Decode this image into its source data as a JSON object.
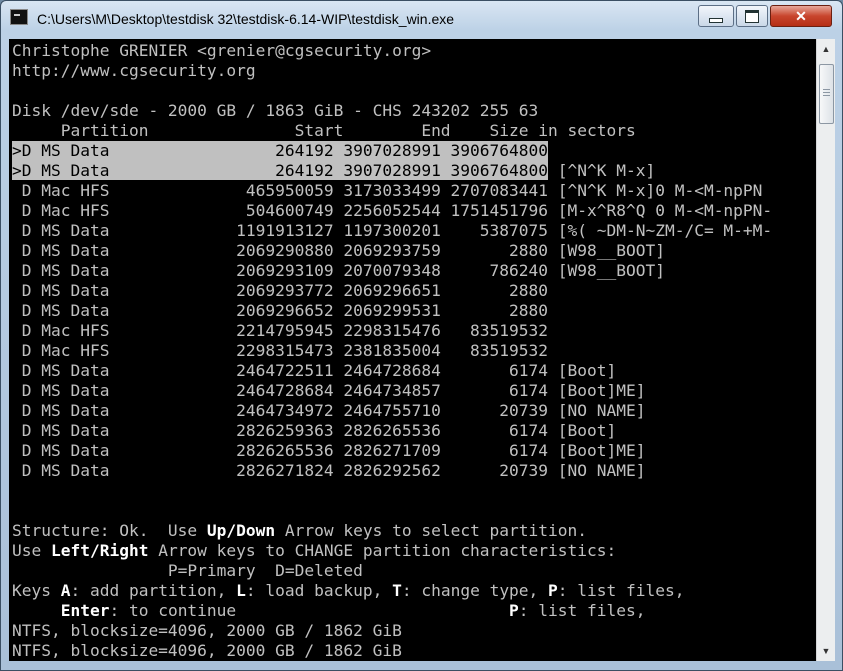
{
  "window": {
    "title": "C:\\Users\\M\\Desktop\\testdisk 32\\testdisk-6.14-WIP\\testdisk_win.exe",
    "close_label": "✕"
  },
  "console": {
    "author": "Christophe GRENIER <grenier@cgsecurity.org>",
    "url": "http://www.cgsecurity.org",
    "disk": "Disk /dev/sde - 2000 GB / 1863 GiB - CHS 243202 255 63",
    "header": "     Partition               Start        End    Size in sectors",
    "rows": [
      ">D MS Data                 264192 3907028991 3906764800",
      ">D MS Data                 264192 3907028991 3906764800",
      " D Mac HFS              465950059 3173033499 2707083441 [^N^K M-x]0 M-<M-npPN",
      " D Mac HFS              504600749 2256052544 1751451796 [M-x^R8^Q 0 M-<M-npPN-",
      " D MS Data             1191913127 1197300201    5387075 [%( ~DM-N~ZM-/C= M-+M-",
      " D MS Data             2069290880 2069293759       2880 [W98__BOOT]",
      " D MS Data             2069293109 2070079348     786240 [W98__BOOT]",
      " D MS Data             2069293772 2069296651       2880",
      " D MS Data             2069296652 2069299531       2880",
      " D Mac HFS             2214795945 2298315476   83519532",
      " D Mac HFS             2298315473 2381835004   83519532",
      " D MS Data             2464722511 2464728684       6174 [Boot]",
      " D MS Data             2464728684 2464734857       6174 [Boot]ME]",
      " D MS Data             2464734972 2464755710      20739 [NO NAME]",
      " D MS Data             2826259363 2826265536       6174 [Boot]",
      " D MS Data             2826265536 2826271709       6174 [Boot]ME]",
      " D MS Data             2826271824 2826292562      20739 [NO NAME]"
    ],
    "row2_tail": " [^N^K M-x]",
    "status1_pre": "Structure: Ok.  Use ",
    "status1_key": "Up/Down",
    "status1_post": " Arrow keys to select partition.",
    "status2_pre": "Use ",
    "status2_key": "Left/Right",
    "status2_post": " Arrow keys to CHANGE partition characteristics:",
    "status3": "                P=Primary  D=Deleted",
    "keys1_pre": "Keys ",
    "keys1_a": "A",
    "keys1_mid1": ": add partition, ",
    "keys1_l": "L",
    "keys1_mid2": ": load backup, ",
    "keys1_t": "T",
    "keys1_mid3": ": change type, ",
    "keys1_p": "P",
    "keys1_post": ": list files,",
    "keys2_pre": "     ",
    "keys2_enter": "Enter",
    "keys2_mid": ": to continue                            ",
    "keys2_p": "P",
    "keys2_post": ": list files,",
    "fs1": "NTFS, blocksize=4096, 2000 GB / 1862 GiB",
    "fs2": "NTFS, blocksize=4096, 2000 GB / 1862 GiB"
  }
}
